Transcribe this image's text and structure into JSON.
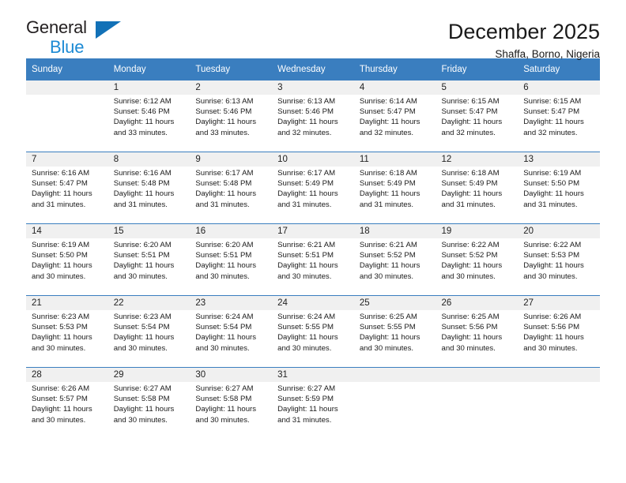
{
  "brand": {
    "name_top": "General",
    "name_bottom": "Blue",
    "triangle_color": "#1271b7",
    "blue_color": "#1c8ad4"
  },
  "header": {
    "title": "December 2025",
    "subtitle": "Shaffa, Borno, Nigeria",
    "header_bg": "#3a7ebf",
    "daynum_bg": "#f0f0f0"
  },
  "weekday_headers": [
    "Sunday",
    "Monday",
    "Tuesday",
    "Wednesday",
    "Thursday",
    "Friday",
    "Saturday"
  ],
  "labels": {
    "sunrise_prefix": "Sunrise:",
    "sunset_prefix": "Sunset:",
    "daylight_prefix": "Daylight:"
  },
  "weeks": [
    [
      {
        "day": "",
        "sunrise": "",
        "sunset": "",
        "daylight_1": "",
        "daylight_2": ""
      },
      {
        "day": "1",
        "sunrise": "Sunrise: 6:12 AM",
        "sunset": "Sunset: 5:46 PM",
        "daylight_1": "Daylight: 11 hours",
        "daylight_2": "and 33 minutes."
      },
      {
        "day": "2",
        "sunrise": "Sunrise: 6:13 AM",
        "sunset": "Sunset: 5:46 PM",
        "daylight_1": "Daylight: 11 hours",
        "daylight_2": "and 33 minutes."
      },
      {
        "day": "3",
        "sunrise": "Sunrise: 6:13 AM",
        "sunset": "Sunset: 5:46 PM",
        "daylight_1": "Daylight: 11 hours",
        "daylight_2": "and 32 minutes."
      },
      {
        "day": "4",
        "sunrise": "Sunrise: 6:14 AM",
        "sunset": "Sunset: 5:47 PM",
        "daylight_1": "Daylight: 11 hours",
        "daylight_2": "and 32 minutes."
      },
      {
        "day": "5",
        "sunrise": "Sunrise: 6:15 AM",
        "sunset": "Sunset: 5:47 PM",
        "daylight_1": "Daylight: 11 hours",
        "daylight_2": "and 32 minutes."
      },
      {
        "day": "6",
        "sunrise": "Sunrise: 6:15 AM",
        "sunset": "Sunset: 5:47 PM",
        "daylight_1": "Daylight: 11 hours",
        "daylight_2": "and 32 minutes."
      }
    ],
    [
      {
        "day": "7",
        "sunrise": "Sunrise: 6:16 AM",
        "sunset": "Sunset: 5:47 PM",
        "daylight_1": "Daylight: 11 hours",
        "daylight_2": "and 31 minutes."
      },
      {
        "day": "8",
        "sunrise": "Sunrise: 6:16 AM",
        "sunset": "Sunset: 5:48 PM",
        "daylight_1": "Daylight: 11 hours",
        "daylight_2": "and 31 minutes."
      },
      {
        "day": "9",
        "sunrise": "Sunrise: 6:17 AM",
        "sunset": "Sunset: 5:48 PM",
        "daylight_1": "Daylight: 11 hours",
        "daylight_2": "and 31 minutes."
      },
      {
        "day": "10",
        "sunrise": "Sunrise: 6:17 AM",
        "sunset": "Sunset: 5:49 PM",
        "daylight_1": "Daylight: 11 hours",
        "daylight_2": "and 31 minutes."
      },
      {
        "day": "11",
        "sunrise": "Sunrise: 6:18 AM",
        "sunset": "Sunset: 5:49 PM",
        "daylight_1": "Daylight: 11 hours",
        "daylight_2": "and 31 minutes."
      },
      {
        "day": "12",
        "sunrise": "Sunrise: 6:18 AM",
        "sunset": "Sunset: 5:49 PM",
        "daylight_1": "Daylight: 11 hours",
        "daylight_2": "and 31 minutes."
      },
      {
        "day": "13",
        "sunrise": "Sunrise: 6:19 AM",
        "sunset": "Sunset: 5:50 PM",
        "daylight_1": "Daylight: 11 hours",
        "daylight_2": "and 31 minutes."
      }
    ],
    [
      {
        "day": "14",
        "sunrise": "Sunrise: 6:19 AM",
        "sunset": "Sunset: 5:50 PM",
        "daylight_1": "Daylight: 11 hours",
        "daylight_2": "and 30 minutes."
      },
      {
        "day": "15",
        "sunrise": "Sunrise: 6:20 AM",
        "sunset": "Sunset: 5:51 PM",
        "daylight_1": "Daylight: 11 hours",
        "daylight_2": "and 30 minutes."
      },
      {
        "day": "16",
        "sunrise": "Sunrise: 6:20 AM",
        "sunset": "Sunset: 5:51 PM",
        "daylight_1": "Daylight: 11 hours",
        "daylight_2": "and 30 minutes."
      },
      {
        "day": "17",
        "sunrise": "Sunrise: 6:21 AM",
        "sunset": "Sunset: 5:51 PM",
        "daylight_1": "Daylight: 11 hours",
        "daylight_2": "and 30 minutes."
      },
      {
        "day": "18",
        "sunrise": "Sunrise: 6:21 AM",
        "sunset": "Sunset: 5:52 PM",
        "daylight_1": "Daylight: 11 hours",
        "daylight_2": "and 30 minutes."
      },
      {
        "day": "19",
        "sunrise": "Sunrise: 6:22 AM",
        "sunset": "Sunset: 5:52 PM",
        "daylight_1": "Daylight: 11 hours",
        "daylight_2": "and 30 minutes."
      },
      {
        "day": "20",
        "sunrise": "Sunrise: 6:22 AM",
        "sunset": "Sunset: 5:53 PM",
        "daylight_1": "Daylight: 11 hours",
        "daylight_2": "and 30 minutes."
      }
    ],
    [
      {
        "day": "21",
        "sunrise": "Sunrise: 6:23 AM",
        "sunset": "Sunset: 5:53 PM",
        "daylight_1": "Daylight: 11 hours",
        "daylight_2": "and 30 minutes."
      },
      {
        "day": "22",
        "sunrise": "Sunrise: 6:23 AM",
        "sunset": "Sunset: 5:54 PM",
        "daylight_1": "Daylight: 11 hours",
        "daylight_2": "and 30 minutes."
      },
      {
        "day": "23",
        "sunrise": "Sunrise: 6:24 AM",
        "sunset": "Sunset: 5:54 PM",
        "daylight_1": "Daylight: 11 hours",
        "daylight_2": "and 30 minutes."
      },
      {
        "day": "24",
        "sunrise": "Sunrise: 6:24 AM",
        "sunset": "Sunset: 5:55 PM",
        "daylight_1": "Daylight: 11 hours",
        "daylight_2": "and 30 minutes."
      },
      {
        "day": "25",
        "sunrise": "Sunrise: 6:25 AM",
        "sunset": "Sunset: 5:55 PM",
        "daylight_1": "Daylight: 11 hours",
        "daylight_2": "and 30 minutes."
      },
      {
        "day": "26",
        "sunrise": "Sunrise: 6:25 AM",
        "sunset": "Sunset: 5:56 PM",
        "daylight_1": "Daylight: 11 hours",
        "daylight_2": "and 30 minutes."
      },
      {
        "day": "27",
        "sunrise": "Sunrise: 6:26 AM",
        "sunset": "Sunset: 5:56 PM",
        "daylight_1": "Daylight: 11 hours",
        "daylight_2": "and 30 minutes."
      }
    ],
    [
      {
        "day": "28",
        "sunrise": "Sunrise: 6:26 AM",
        "sunset": "Sunset: 5:57 PM",
        "daylight_1": "Daylight: 11 hours",
        "daylight_2": "and 30 minutes."
      },
      {
        "day": "29",
        "sunrise": "Sunrise: 6:27 AM",
        "sunset": "Sunset: 5:58 PM",
        "daylight_1": "Daylight: 11 hours",
        "daylight_2": "and 30 minutes."
      },
      {
        "day": "30",
        "sunrise": "Sunrise: 6:27 AM",
        "sunset": "Sunset: 5:58 PM",
        "daylight_1": "Daylight: 11 hours",
        "daylight_2": "and 30 minutes."
      },
      {
        "day": "31",
        "sunrise": "Sunrise: 6:27 AM",
        "sunset": "Sunset: 5:59 PM",
        "daylight_1": "Daylight: 11 hours",
        "daylight_2": "and 31 minutes."
      },
      {
        "day": "",
        "sunrise": "",
        "sunset": "",
        "daylight_1": "",
        "daylight_2": ""
      },
      {
        "day": "",
        "sunrise": "",
        "sunset": "",
        "daylight_1": "",
        "daylight_2": ""
      },
      {
        "day": "",
        "sunrise": "",
        "sunset": "",
        "daylight_1": "",
        "daylight_2": ""
      }
    ]
  ]
}
